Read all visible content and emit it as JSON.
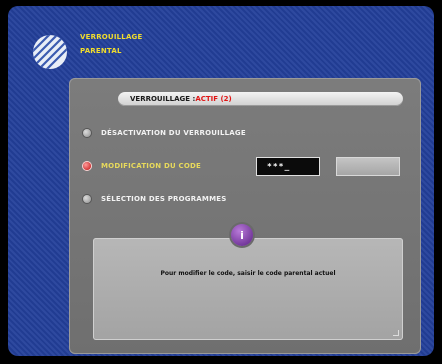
{
  "header": {
    "title_line1": "VERROUILLAGE",
    "title_line2": "PARENTAL"
  },
  "status": {
    "prefix": "VERROUILLAGE : ",
    "state": "ACTIF (2)"
  },
  "options": [
    {
      "label": "DÉSACTIVATION DU VERROUILLAGE",
      "selected": false
    },
    {
      "label": "MODIFICATION DU CODE",
      "selected": true
    },
    {
      "label": "SÉLECTION DES PROGRAMMES",
      "selected": false
    }
  ],
  "code_field": {
    "value": "***_"
  },
  "info": {
    "icon": "info-icon",
    "badge": "i",
    "message": "Pour modifier le code, saisir le code parental actuel"
  },
  "colors": {
    "background": "#233f9a",
    "title": "#f1dd2c",
    "active": "#e01616",
    "panel": "#767676"
  }
}
